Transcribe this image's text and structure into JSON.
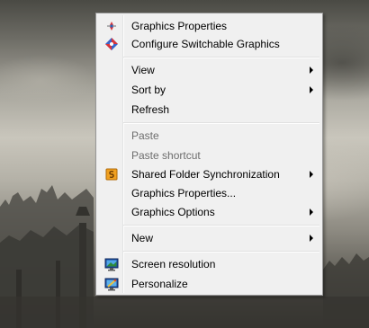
{
  "context_menu": {
    "items": [
      {
        "label": "Graphics Properties",
        "icon": "intel-graphics-icon",
        "submenu": false,
        "enabled": true
      },
      {
        "label": "Configure Switchable Graphics",
        "icon": "switchable-graphics-icon",
        "submenu": false,
        "enabled": true
      },
      {
        "label": "View",
        "submenu": true,
        "enabled": true
      },
      {
        "label": "Sort by",
        "submenu": true,
        "enabled": true
      },
      {
        "label": "Refresh",
        "submenu": false,
        "enabled": true
      },
      {
        "label": "Paste",
        "submenu": false,
        "enabled": false
      },
      {
        "label": "Paste shortcut",
        "submenu": false,
        "enabled": false
      },
      {
        "label": "Shared Folder Synchronization",
        "icon": "shared-folder-sync-icon",
        "submenu": true,
        "enabled": true
      },
      {
        "label": "Graphics Properties...",
        "submenu": false,
        "enabled": true
      },
      {
        "label": "Graphics Options",
        "submenu": true,
        "enabled": true
      },
      {
        "label": "New",
        "submenu": true,
        "enabled": true
      },
      {
        "label": "Screen resolution",
        "icon": "screen-resolution-icon",
        "submenu": false,
        "enabled": true
      },
      {
        "label": "Personalize",
        "icon": "personalize-icon",
        "submenu": false,
        "enabled": true
      }
    ]
  },
  "colors": {
    "menu_background": "#f0f0f0",
    "menu_border": "#979797",
    "disabled_text": "#6d6d6d"
  }
}
